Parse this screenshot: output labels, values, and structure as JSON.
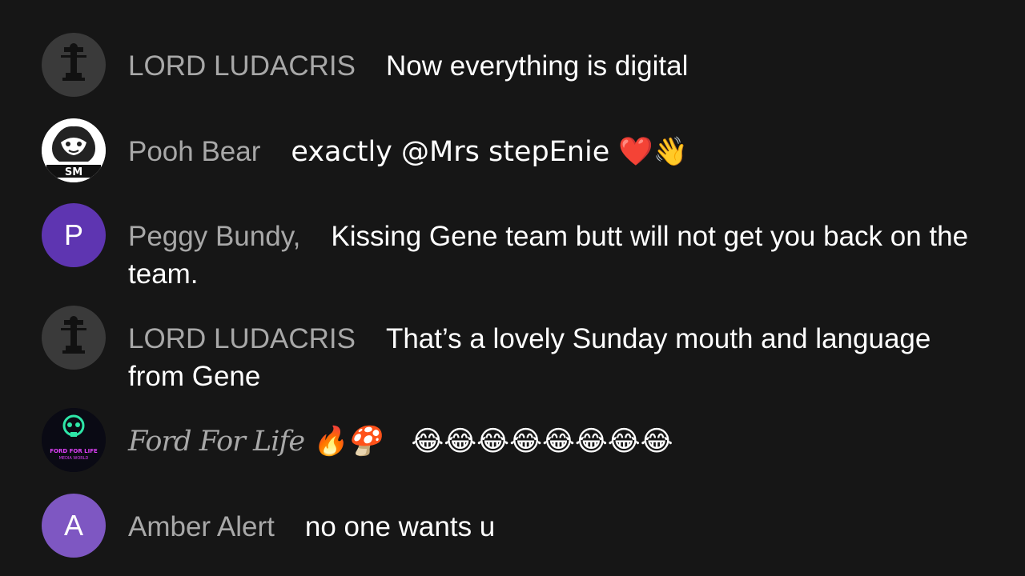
{
  "partial_message": {
    "text": "team"
  },
  "messages": [
    {
      "author": "LORD LUDACRIS",
      "text": "Now everything is digital",
      "avatar": {
        "kind": "image",
        "icon": "statue-avatar",
        "bg": "#3a3a3a"
      }
    },
    {
      "author": "Pooh Bear",
      "text": "exactly @Mrs stepEnie ❤️👋",
      "avatar": {
        "kind": "image",
        "icon": "bulldog-logo-avatar",
        "bg": "#ffffff",
        "logo_text": "SM"
      }
    },
    {
      "author": "Peggy Bundy,",
      "text": "Kissing Gene team butt will not get you back on the team.",
      "avatar": {
        "kind": "letter",
        "letter": "P",
        "bg": "#5e35b1"
      }
    },
    {
      "author": "LORD LUDACRIS",
      "text": "That’s a lovely Sunday mouth and language from Gene",
      "avatar": {
        "kind": "image",
        "icon": "statue-avatar",
        "bg": "#3a3a3a"
      }
    },
    {
      "author": "Ford For Life 🔥🍄",
      "text": "😂😂😂😂😂😂😂😂",
      "avatar": {
        "kind": "image",
        "icon": "skull-logo-avatar",
        "bg": "#0a0a14",
        "logo_text": "FORD FOR LIFE",
        "logo_subtext": "MEDIA WORLD"
      }
    },
    {
      "author": "Amber Alert",
      "text": "no one wants u",
      "avatar": {
        "kind": "letter",
        "letter": "A",
        "bg": "#7e57c2"
      }
    }
  ],
  "colors": {
    "background": "#161616",
    "author": "#a8a8a8",
    "message": "#ffffff"
  }
}
